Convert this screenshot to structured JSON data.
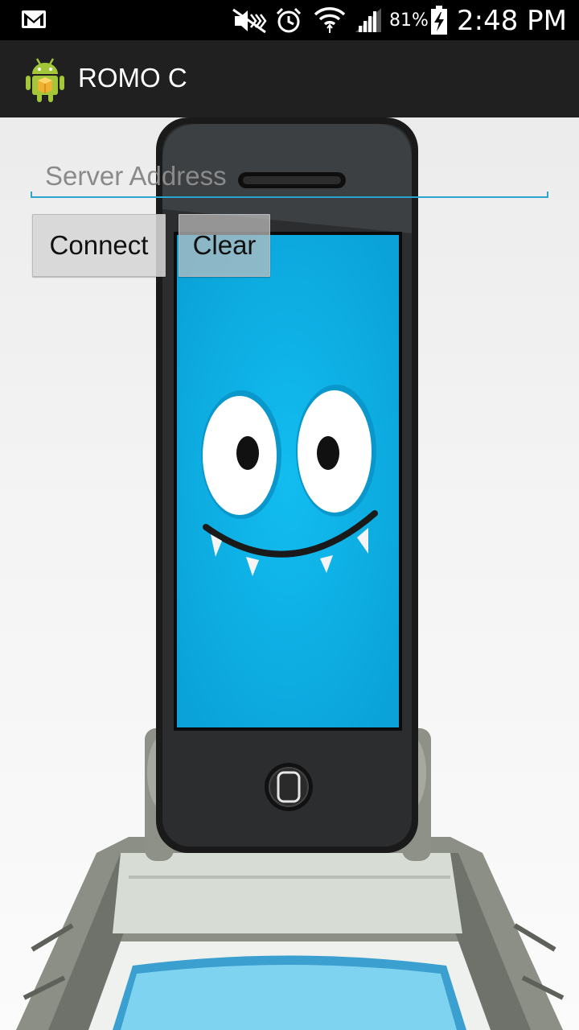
{
  "status_bar": {
    "battery_percent": "81%",
    "time": "2:48 PM",
    "icons": [
      "gmail-icon",
      "mute-icon",
      "alarm-icon",
      "wifi-icon",
      "signal-icon",
      "battery-charging-icon"
    ]
  },
  "action_bar": {
    "title": "ROMO C",
    "icon": "android-app-icon"
  },
  "form": {
    "server_placeholder": "Server Address",
    "server_value": "",
    "connect_label": "Connect",
    "clear_label": "Clear"
  },
  "colors": {
    "accent": "#2aa5d0",
    "screen_blue": "#10b4e8",
    "action_bar": "#202020"
  }
}
